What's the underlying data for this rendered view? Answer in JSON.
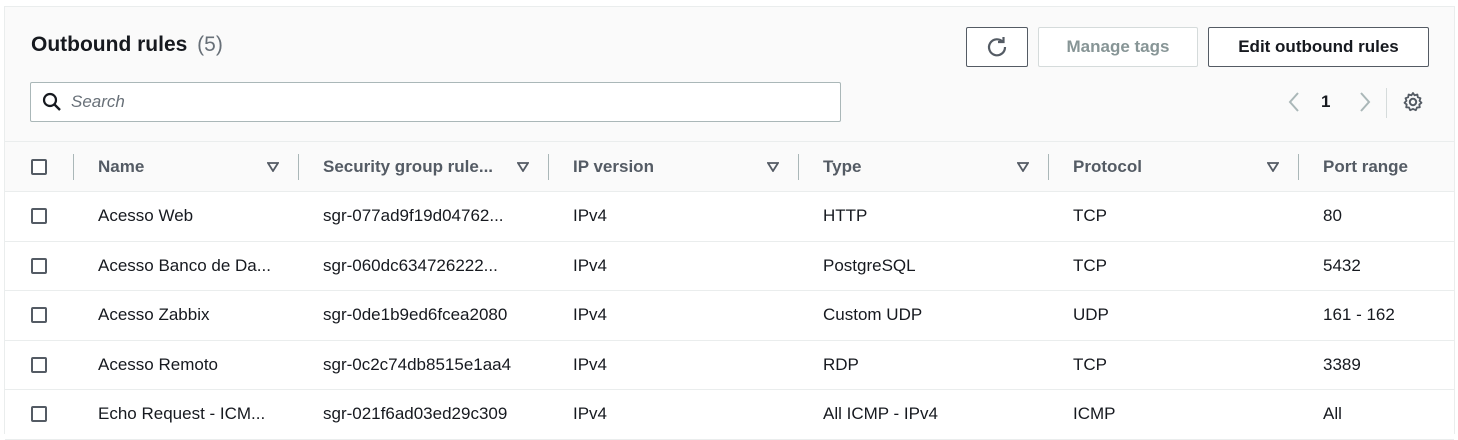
{
  "header": {
    "title": "Outbound rules",
    "count": "(5)",
    "manage_tags_label": "Manage tags",
    "edit_label": "Edit outbound rules"
  },
  "search": {
    "placeholder": "Search",
    "value": ""
  },
  "pagination": {
    "current_page": "1"
  },
  "columns": [
    "Name",
    "Security group rule...",
    "IP version",
    "Type",
    "Protocol",
    "Port range"
  ],
  "rows": [
    {
      "name": "Acesso Web",
      "sgr": "sgr-077ad9f19d04762...",
      "ip": "IPv4",
      "type": "HTTP",
      "protocol": "TCP",
      "port": "80"
    },
    {
      "name": "Acesso Banco de Da...",
      "sgr": "sgr-060dc634726222...",
      "ip": "IPv4",
      "type": "PostgreSQL",
      "protocol": "TCP",
      "port": "5432"
    },
    {
      "name": "Acesso Zabbix",
      "sgr": "sgr-0de1b9ed6fcea2080",
      "ip": "IPv4",
      "type": "Custom UDP",
      "protocol": "UDP",
      "port": "161 - 162"
    },
    {
      "name": "Acesso Remoto",
      "sgr": "sgr-0c2c74db8515e1aa4",
      "ip": "IPv4",
      "type": "RDP",
      "protocol": "TCP",
      "port": "3389"
    },
    {
      "name": "Echo Request - ICM...",
      "sgr": "sgr-021f6ad03ed29c309",
      "ip": "IPv4",
      "type": "All ICMP - IPv4",
      "protocol": "ICMP",
      "port": "All"
    }
  ],
  "colors": {
    "text": "#16191f",
    "muted": "#687078",
    "border": "#eaeded",
    "header_bg": "#fafafa"
  }
}
